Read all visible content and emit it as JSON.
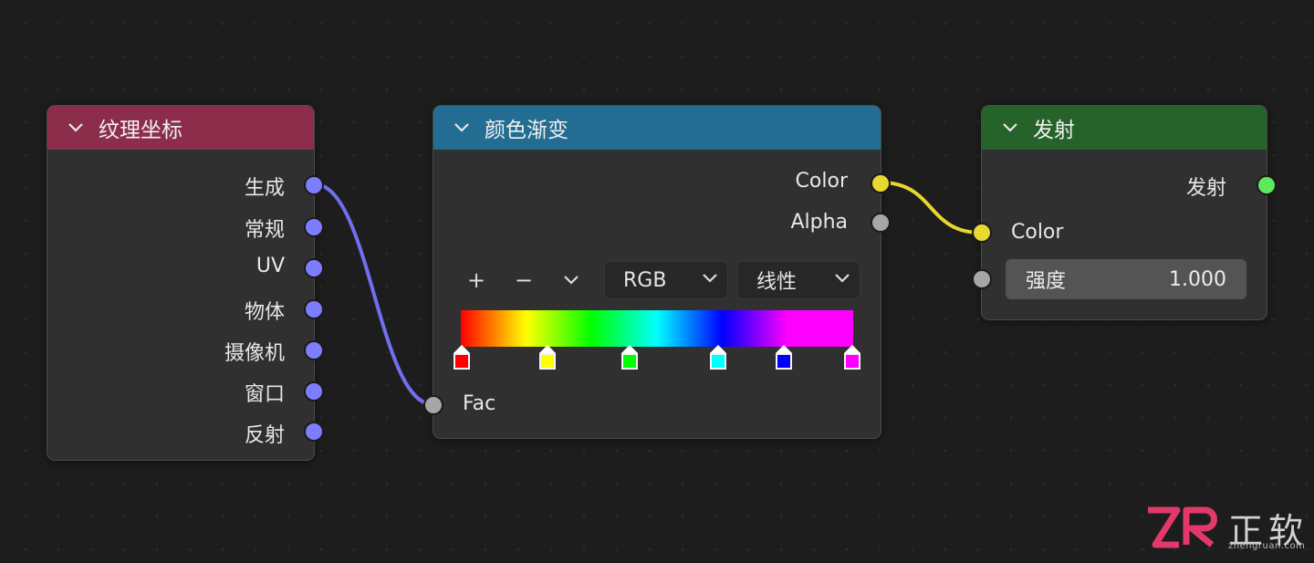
{
  "colors": {
    "canvas": "#1d1d1d",
    "node_body": "#303030",
    "header_texcoord": "#8c2e4b",
    "header_colorramp": "#246d92",
    "header_emission": "#25632a",
    "socket_vector": "#7d7dff",
    "socket_color": "#e8d832",
    "socket_float": "#a6a6a6",
    "socket_shader": "#5ee85e"
  },
  "nodes": {
    "texcoord": {
      "title": "纹理坐标",
      "outputs": [
        "生成",
        "常规",
        "UV",
        "物体",
        "摄像机",
        "窗口",
        "反射"
      ]
    },
    "colorramp": {
      "title": "颜色渐变",
      "outputs": [
        "Color",
        "Alpha"
      ],
      "toolbar": {
        "add": "+",
        "remove": "−",
        "color_mode": "RGB",
        "interpolation": "线性"
      },
      "stops": [
        "#ff0000",
        "#ffff00",
        "#00ff00",
        "#00ffff",
        "#0000ff",
        "#ff00ff"
      ],
      "input": "Fac"
    },
    "emission": {
      "title": "发射",
      "output": "发射",
      "input_color": "Color",
      "strength_label": "强度",
      "strength_value": "1.000"
    }
  },
  "logo": {
    "mark": "ZR",
    "name": "正软",
    "url": "zhengruan.com"
  }
}
